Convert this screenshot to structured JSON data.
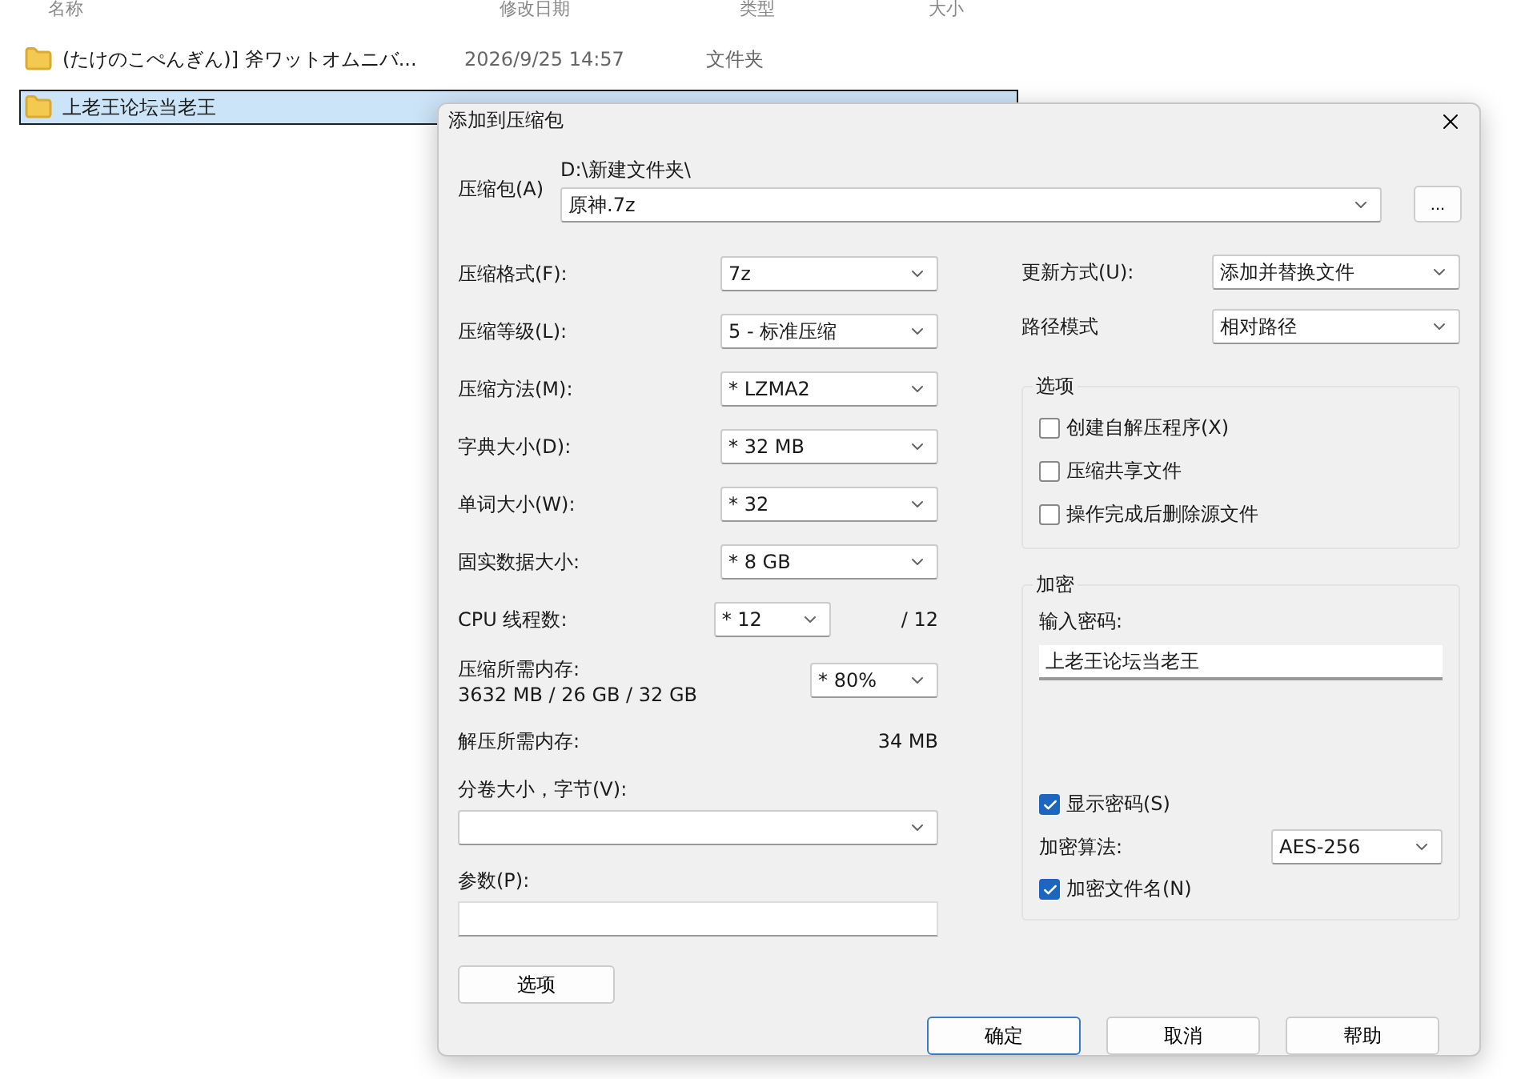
{
  "explorer": {
    "columns": [
      "名称",
      "修改日期",
      "类型",
      "大小"
    ],
    "rows": [
      {
        "name": "(たけのこぺんぎん)] 斧ワットオムニバ...",
        "date": "2026/9/25 14:57",
        "type": "文件夹",
        "selected": false
      },
      {
        "name": "上老王论坛当老王",
        "selected": true
      }
    ]
  },
  "dialog": {
    "title": "添加到压缩包",
    "archive": {
      "label": "压缩包(A)",
      "path": "D:\\新建文件夹\\",
      "value": "原神.7z",
      "browse": "..."
    },
    "left_fields": [
      {
        "kind": "select",
        "label": "压缩格式(F):",
        "value": "7z"
      },
      {
        "kind": "select",
        "label": "压缩等级(L):",
        "value": "5 - 标准压缩"
      },
      {
        "kind": "select",
        "label": "压缩方法(M):",
        "value": "* LZMA2"
      },
      {
        "kind": "select",
        "label": "字典大小(D):",
        "value": "* 32 MB"
      },
      {
        "kind": "select",
        "label": "单词大小(W):",
        "value": "* 32"
      },
      {
        "kind": "select",
        "label": "固实数据大小:",
        "value": "* 8 GB"
      },
      {
        "kind": "select_total",
        "label": "CPU 线程数:",
        "value": "* 12",
        "total": "/ 12"
      },
      {
        "kind": "memory",
        "label": "压缩所需内存:",
        "detail": "3632 MB / 26 GB / 32 GB",
        "value": "* 80%"
      },
      {
        "kind": "info",
        "label": "解压所需内存:",
        "value": "34 MB"
      }
    ],
    "volume": {
      "label": "分卷大小，字节(V):"
    },
    "params": {
      "label": "参数(P):"
    },
    "options_button": "选项",
    "right_fields": [
      {
        "label": "更新方式(U):",
        "value": "添加并替换文件"
      },
      {
        "label": "路径模式",
        "value": "相对路径"
      }
    ],
    "options_group": {
      "title": "选项",
      "items": [
        {
          "label": "创建自解压程序(X)",
          "checked": false
        },
        {
          "label": "压缩共享文件",
          "checked": false
        },
        {
          "label": "操作完成后删除源文件",
          "checked": false
        }
      ]
    },
    "encryption": {
      "title": "加密",
      "password_label": "输入密码:",
      "password": "上老王论坛当老王",
      "show_password": {
        "label": "显示密码(S)",
        "checked": true
      },
      "method_label": "加密算法:",
      "method": "AES-256",
      "encrypt_names": {
        "label": "加密文件名(N)",
        "checked": true
      }
    },
    "buttons": [
      {
        "label": "确定",
        "selected": true
      },
      {
        "label": "取消",
        "selected": false
      },
      {
        "label": "帮助",
        "selected": false
      }
    ]
  }
}
